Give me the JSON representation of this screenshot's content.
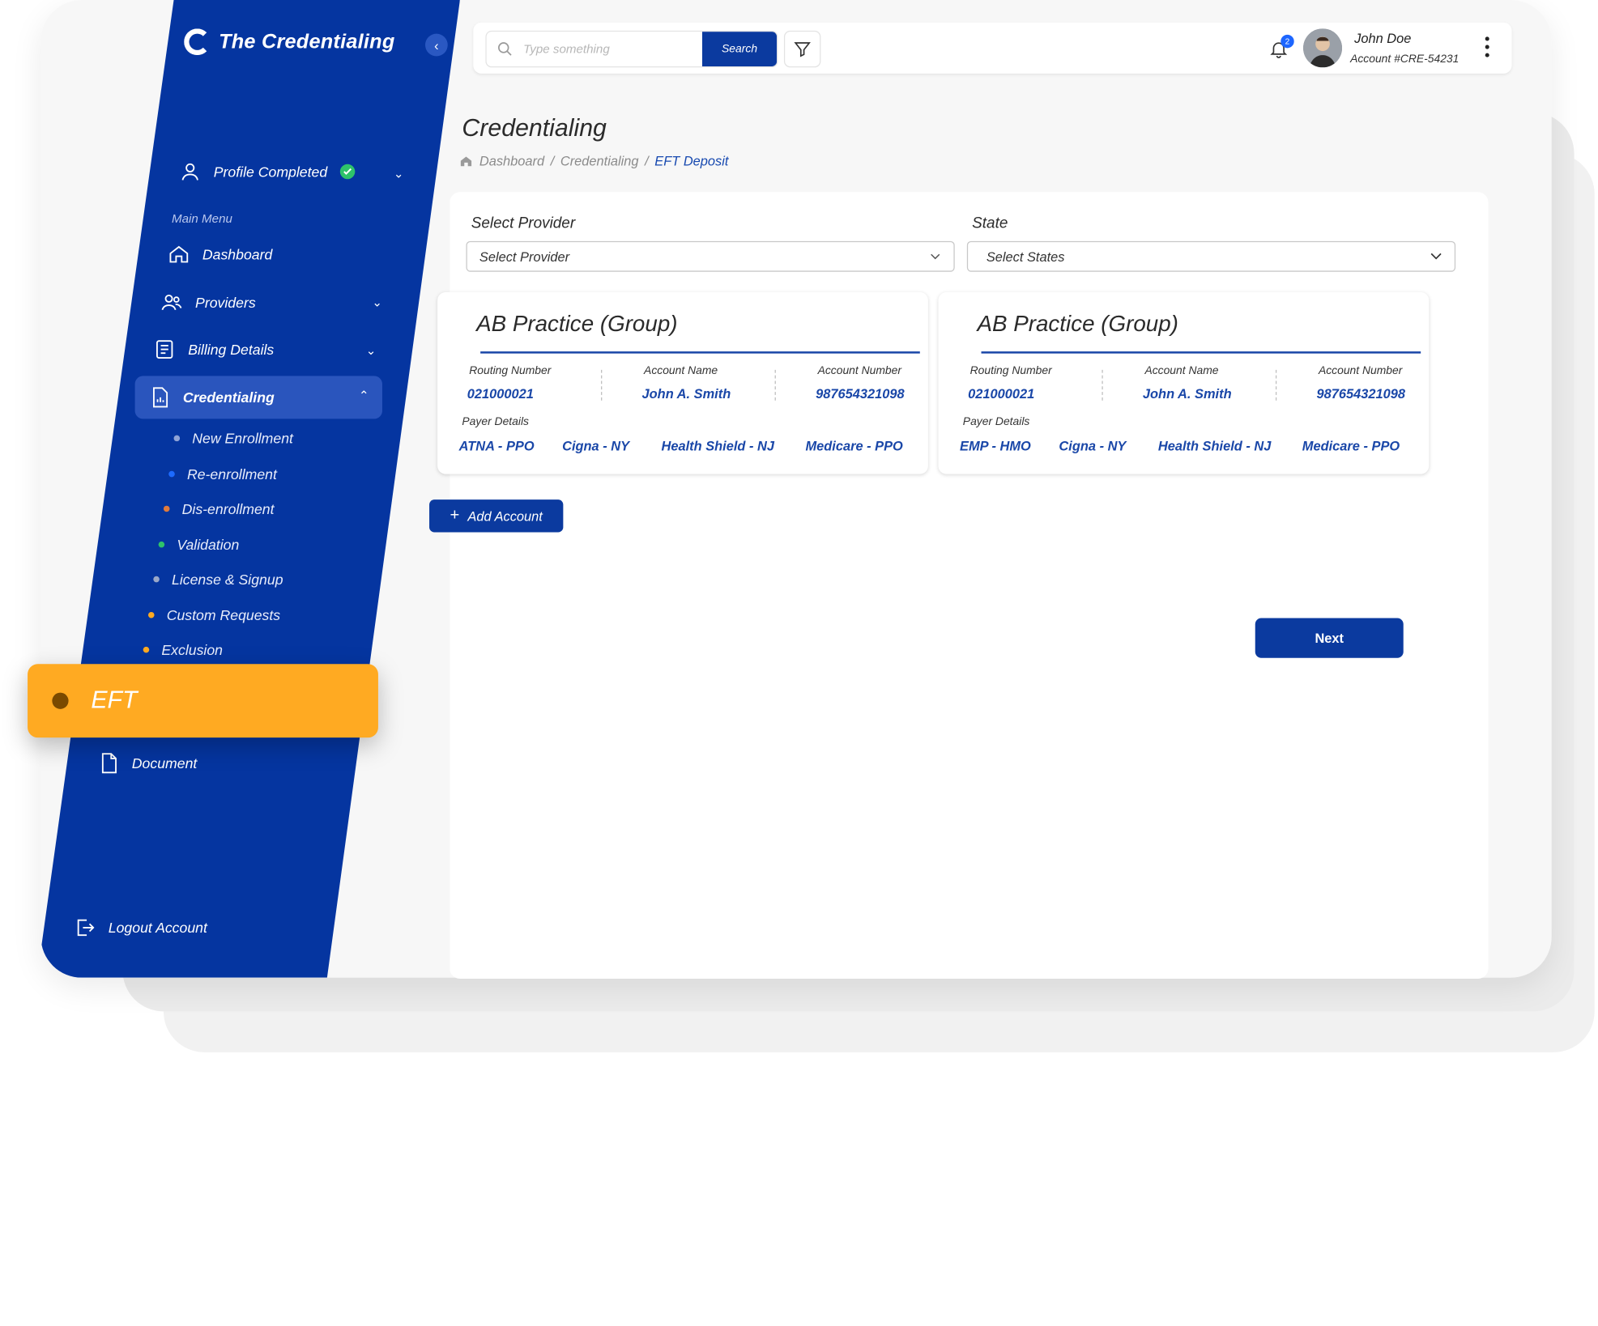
{
  "app": {
    "logo_text": "The Credentialing"
  },
  "topbar": {
    "search_placeholder": "Type something",
    "search_button": "Search",
    "notification_count": "2",
    "user_name": "John Doe",
    "user_account": "Account #CRE-54231"
  },
  "sidebar": {
    "profile_label": "Profile Completed",
    "section_label": "Main Menu",
    "items": {
      "dashboard": "Dashboard",
      "providers": "Providers",
      "billing": "Billing Details",
      "credentialing": "Credentialing"
    },
    "sub_items": [
      {
        "label": "New Enrollment",
        "dot_color": "#8fa3d6"
      },
      {
        "label": "Re-enrollment",
        "dot_color": "#1d6bff"
      },
      {
        "label": "Dis-enrollment",
        "dot_color": "#e07a3c"
      },
      {
        "label": "Validation",
        "dot_color": "#2ec26a"
      },
      {
        "label": "License & Signup",
        "dot_color": "#9aa8c8"
      },
      {
        "label": "Custom Requests",
        "dot_color": "#ffaa22"
      },
      {
        "label": "Exclusion",
        "dot_color": "#ffaa22"
      }
    ],
    "eft_label": "EFT",
    "document_label": "Document",
    "logout_label": "Logout Account"
  },
  "page": {
    "title": "Credentialing",
    "breadcrumb": [
      "Dashboard",
      "Credentialing",
      "EFT Deposit"
    ]
  },
  "form": {
    "provider_label": "Select Provider",
    "provider_placeholder": "Select Provider",
    "state_label": "State",
    "state_placeholder": "Select States"
  },
  "cards": [
    {
      "title": "AB Practice  (Group)",
      "routing_label": "Routing Number",
      "routing": "021000021",
      "name_label": "Account Name",
      "name": "John A. Smith",
      "number_label": "Account Number",
      "number": "987654321098",
      "payer_label": "Payer Details",
      "payers": [
        "ATNA - PPO",
        "Cigna - NY",
        "Health Shield - NJ",
        "Medicare - PPO"
      ]
    },
    {
      "title": "AB Practice  (Group)",
      "routing_label": "Routing Number",
      "routing": "021000021",
      "name_label": "Account Name",
      "name": "John A. Smith",
      "number_label": "Account Number",
      "number": "987654321098",
      "payer_label": "Payer Details",
      "payers": [
        "EMP - HMO",
        "Cigna - NY",
        "Health Shield - NJ",
        "Medicare - PPO"
      ]
    }
  ],
  "actions": {
    "add_account": "Add Account",
    "next": "Next"
  },
  "colors": {
    "sidebar": "#0535a0",
    "accent": "#ffaa22",
    "primary_button": "#0b3a9f",
    "link_text": "#1a47a8"
  }
}
